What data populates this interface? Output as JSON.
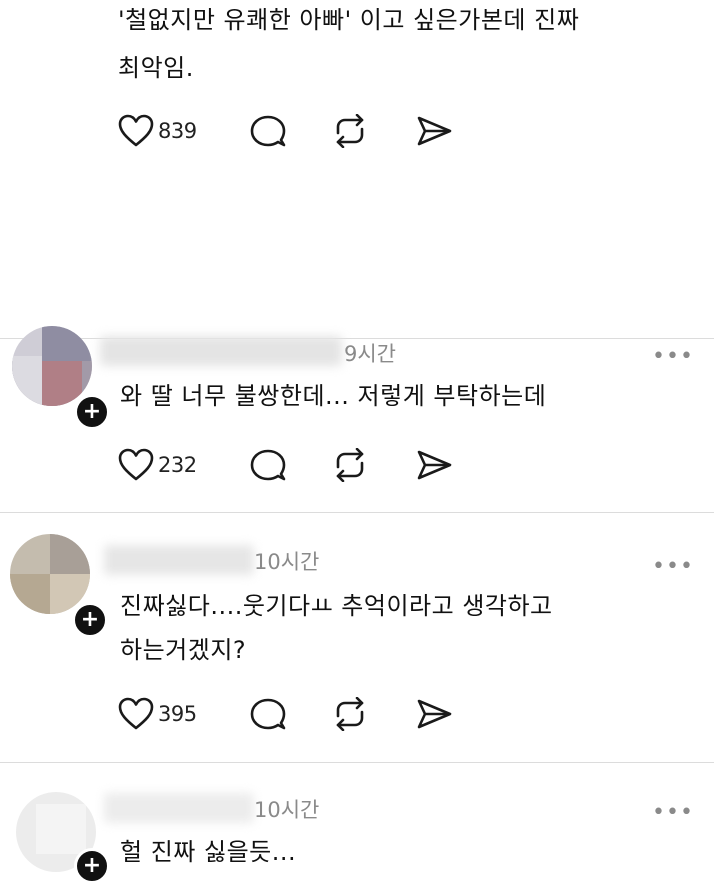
{
  "posts": [
    {
      "text_lines": [
        "'철없지만 유쾌한 아빠' 이고 싶은가본데 진짜",
        "최악임."
      ],
      "likes": "839"
    },
    {
      "time": "9시간",
      "text_lines": [
        "와 딸 너무 불쌍한데... 저렇게 부탁하는데"
      ],
      "likes": "232"
    },
    {
      "time": "10시간",
      "text_lines": [
        "진짜싫다....웃기다ㅛ 추억이라고 생각하고",
        "하는거겠지?"
      ],
      "likes": "395"
    },
    {
      "time": "10시간",
      "text_lines": [
        "헐 진짜 싫을듯..."
      ]
    }
  ],
  "icons": {
    "like": "heart-icon",
    "reply": "comment-icon",
    "repost": "repost-icon",
    "share": "send-icon",
    "more": "more-icon",
    "follow": "plus-icon"
  },
  "more_glyph": "•••",
  "follow_glyph": "+"
}
